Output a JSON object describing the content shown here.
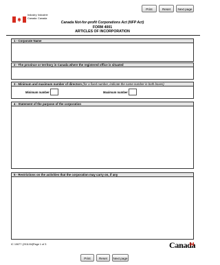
{
  "top_buttons": {
    "print": "Print",
    "reset": "Reset",
    "next": "Next page"
  },
  "bottom_buttons": {
    "print": "Print",
    "reset": "Reset",
    "next": "Next page"
  },
  "header": {
    "dept_en_line1": "Industry",
    "dept_en_line2": "Canada",
    "dept_fr_line1": "Industrie",
    "dept_fr_line2": "Canada",
    "act": "Canada Not-for-profit Corporations Act (NFP Act)",
    "form": "FORM 4001",
    "title": "ARTICLES OF INCORPORATION"
  },
  "sections": {
    "s1": {
      "label": "1 - Corporate Name"
    },
    "s2": {
      "label": "2 - The province or territory in Canada where the registered office is situated"
    },
    "s3": {
      "label": "3 - Minimum and maximum number of directors",
      "note": "(for a fixed number, indicate the same number in both boxes)",
      "min_label": "Minimum number",
      "max_label": "Maximum number",
      "min_value": "",
      "max_value": ""
    },
    "s4": {
      "label": "4 - Statement of the purpose of the corporation"
    },
    "s5": {
      "label": "5 - Restrictions on the activities that the corporation may carry on, if any"
    }
  },
  "footer": {
    "form_code": "IC 10677 (2011/04)",
    "page": "Page 1 of 3",
    "wordmark": "Canada",
    "colors": {
      "flag_red": "#d52b1e"
    }
  }
}
